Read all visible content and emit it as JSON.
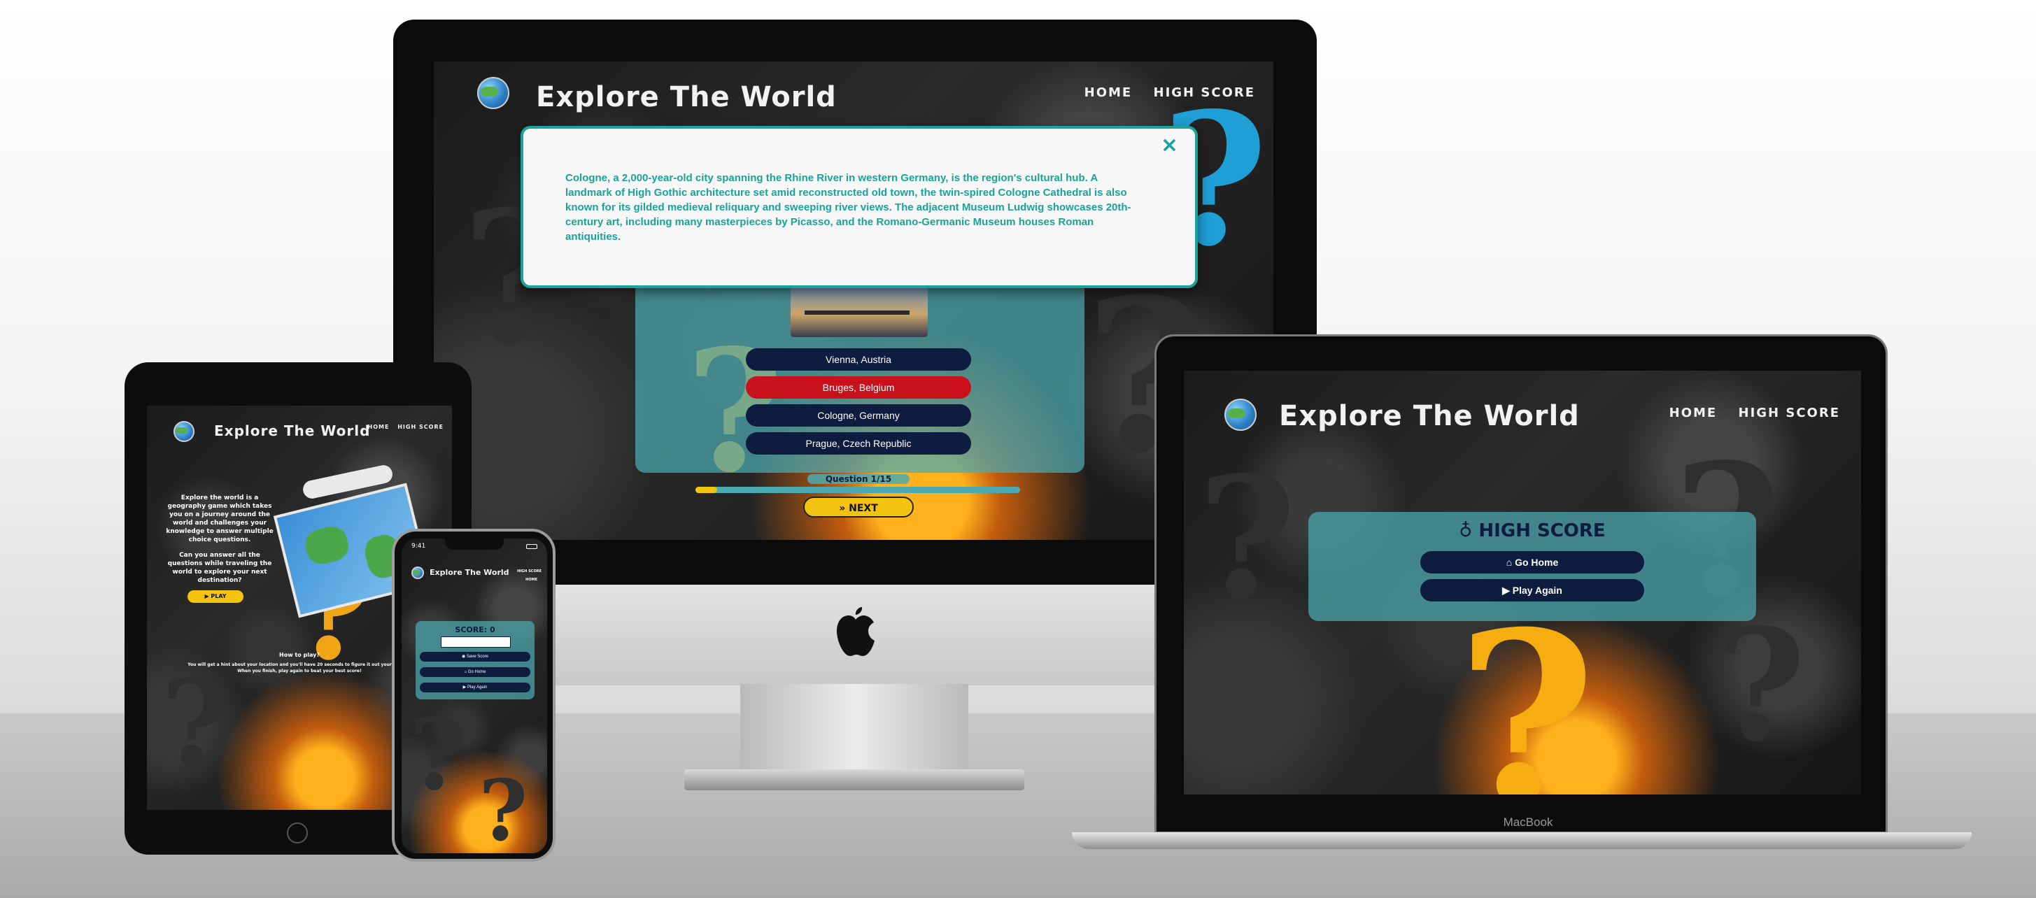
{
  "site": {
    "title": "Explore The World",
    "nav_home": "HOME",
    "nav_high_score": "HIGH SCORE"
  },
  "imac": {
    "modal_text": "Cologne, a 2,000-year-old city spanning the Rhine River in western Germany, is the region's cultural hub. A landmark of High Gothic architecture set amid reconstructed old town, the twin-spired Cologne Cathedral is also known for its gilded medieval reliquary and sweeping river views. The adjacent Museum Ludwig showcases 20th-century art, including many masterpieces by Picasso, and the Romano-Germanic Museum houses Roman antiquities.",
    "close_symbol": "×",
    "answers": [
      "Vienna, Austria",
      "Bruges, Belgium",
      "Cologne, Germany",
      "Prague, Czech Republic"
    ],
    "question_counter": "Question 1/15",
    "progress": 0.067,
    "next_label": "» NEXT"
  },
  "macbook": {
    "high_score_title": "HIGH SCORE",
    "go_home": "Go Home",
    "play_again": "Play Again",
    "brand": "MacBook"
  },
  "ipad": {
    "intro_1": "Explore the world is a geography game which takes you on a journey around the world and challenges your knowledge to answer multiple choice questions.",
    "intro_2": "Can you answer all the questions while traveling the world to explore your next destination?",
    "play_label": "▶ PLAY",
    "how_to_title": "How to play?",
    "how_to_text": "You will get a hint about your location and you'll have 20 seconds to figure it out your answer. When you finish, play again to beat your best score!"
  },
  "iphone": {
    "time": "9:41",
    "score_label": "SCORE: 0",
    "save_score": "Save Score",
    "go_home": "Go Home",
    "play_again": "Play Again",
    "nav_high": "HIGH SCORE",
    "nav_home": "HOME"
  },
  "colors": {
    "navy": "#0e1c3f",
    "teal_panel": "#4caab2",
    "wrong_red": "#c8111b",
    "next_yellow": "#f2c40f",
    "modal_border": "#1aa39a"
  }
}
